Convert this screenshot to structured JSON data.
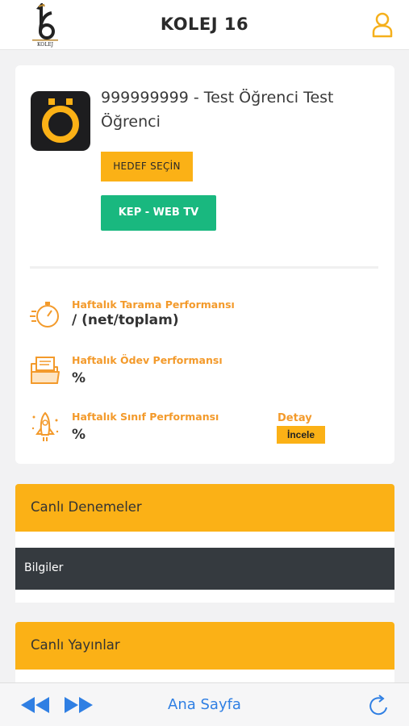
{
  "header": {
    "logo_text": "KOLEJ",
    "app_title": "KOLEJ 16",
    "user_icon": "user-icon"
  },
  "profile": {
    "avatar_letter": "Ö",
    "student_name": "999999999 - Test Öğrenci Test Öğrenci",
    "goal_button": "HEDEF SEÇİN",
    "tv_button": "KEP - WEB TV"
  },
  "performance": [
    {
      "icon": "stopwatch-icon",
      "label": "Haftalık Tarama Performansı",
      "value": "/ (net/toplam)"
    },
    {
      "icon": "folder-icon",
      "label": "Haftalık Ödev Performansı",
      "value": "%"
    },
    {
      "icon": "rocket-icon",
      "label": "Haftalık Sınıf Performansı",
      "value": "%"
    }
  ],
  "detail": {
    "label": "Detay",
    "button": "İncele"
  },
  "sections": {
    "live_exams": "Canlı Denemeler",
    "info": "Bilgiler",
    "live_streams": "Canlı Yayınlar"
  },
  "bottom_nav": {
    "home_label": "Ana Sayfa",
    "back_icon": "rewind-icon",
    "forward_icon": "fast-forward-icon",
    "refresh_icon": "refresh-icon"
  },
  "colors": {
    "accent": "#fbb116",
    "green": "#19b87f",
    "dark": "#353a3f",
    "orange_text": "#f39a2b",
    "link_blue": "#2f7fe3"
  }
}
